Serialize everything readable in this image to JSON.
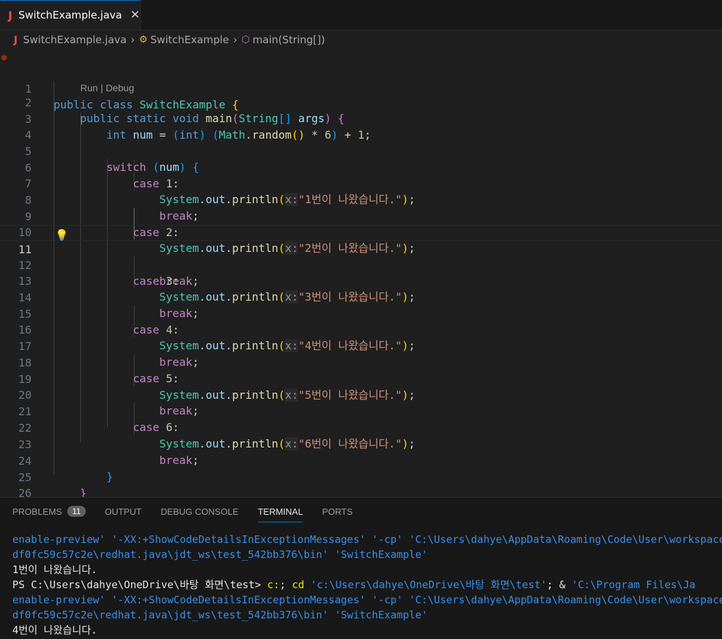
{
  "tab": {
    "icon": "J",
    "filename": "SwitchExample.java",
    "close": "✕"
  },
  "breadcrumb": {
    "file": "SwitchExample.java",
    "class": "SwitchExample",
    "method": "main(String[])"
  },
  "codelens": "Run | Debug",
  "line_numbers": [
    "1",
    "2",
    "3",
    "4",
    "5",
    "6",
    "7",
    "8",
    "9",
    "10",
    "11",
    "12",
    "13",
    "14",
    "15",
    "16",
    "17",
    "18",
    "19",
    "20",
    "21",
    "22",
    "23",
    "24",
    "25",
    "26"
  ],
  "active_line": "11",
  "code": {
    "public": "public",
    "class": "class",
    "static": "static",
    "void": "void",
    "int": "int",
    "switch": "switch",
    "case": "case",
    "break": "break",
    "class_name": "SwitchExample",
    "main": "main",
    "String": "String",
    "args": "args",
    "num": "num",
    "Math": "Math",
    "random": "random",
    "System": "System",
    "out": "out",
    "println": "println",
    "hint": "x:",
    "six": "6",
    "one": "1",
    "cases": [
      "1",
      "2",
      "3",
      "4",
      "5",
      "6"
    ],
    "strings": [
      "\"1번이 나왔습니다.\"",
      "\"2번이 나왔습니다.\"",
      "\"3번이 나왔습니다.\"",
      "\"4번이 나왔습니다.\"",
      "\"5번이 나왔습니다.\"",
      "\"6번이 나왔습니다.\""
    ]
  },
  "panel": {
    "tabs": [
      "PROBLEMS",
      "OUTPUT",
      "DEBUG CONSOLE",
      "TERMINAL",
      "PORTS"
    ],
    "problems_count": "11",
    "active_tab": "TERMINAL"
  },
  "terminal": {
    "l1": "enable-preview' '-XX:+ShowCodeDetailsInExceptionMessages' '-cp' 'C:\\Users\\dahye\\AppData\\Roaming\\Code\\User\\workspace",
    "l2": "df0fc59c57c2e\\redhat.java\\jdt_ws\\test_542bb376\\bin' 'SwitchExample'",
    "l3": "1번이 나왔습니다.",
    "l4_prompt": "PS C:\\Users\\dahye\\OneDrive\\바탕 화면\\test> ",
    "l4_cmd1": "c:",
    "l4_semi": "; ",
    "l4_cd": "cd",
    "l4_path": "'c:\\Users\\dahye\\OneDrive\\바탕 화면\\test'",
    "l4_amp": "; & ",
    "l4_java": "'C:\\Program Files\\Ja",
    "l5": "enable-preview' '-XX:+ShowCodeDetailsInExceptionMessages' '-cp' 'C:\\Users\\dahye\\AppData\\Roaming\\Code\\User\\workspace",
    "l6": "df0fc59c57c2e\\redhat.java\\jdt_ws\\test_542bb376\\bin' 'SwitchExample'",
    "l7": "4번이 나왔습니다."
  }
}
